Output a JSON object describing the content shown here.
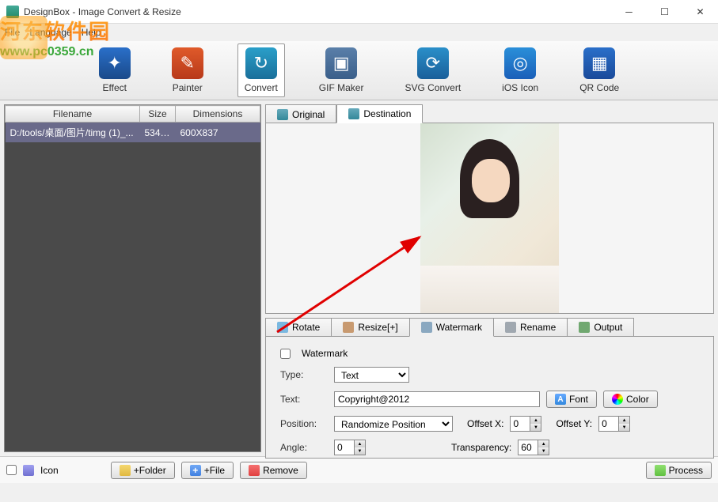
{
  "window": {
    "title": "DesignBox - Image Convert & Resize"
  },
  "watermark_overlay": {
    "cn_text": "河东软件园",
    "url": "www.pc0359.cn"
  },
  "menu": {
    "file": "File",
    "language": "Language",
    "help": "Help"
  },
  "toolbar": {
    "effect": "Effect",
    "painter": "Painter",
    "convert": "Convert",
    "gifmaker": "GIF Maker",
    "svgconvert": "SVG Convert",
    "iosicon": "iOS Icon",
    "qrcode": "QR Code"
  },
  "file_table": {
    "headers": {
      "filename": "Filename",
      "size": "Size",
      "dimensions": "Dimensions"
    },
    "rows": [
      {
        "filename": "D:/tools/桌面/图片/timg (1)_...",
        "size": "534....",
        "dimensions": "600X837"
      }
    ]
  },
  "preview_tabs": {
    "original": "Original",
    "destination": "Destination"
  },
  "settings_tabs": {
    "rotate": "Rotate",
    "resize": "Resize[+]",
    "watermark": "Watermark",
    "rename": "Rename",
    "output": "Output"
  },
  "watermark_panel": {
    "checkbox_label": "Watermark",
    "checked": false,
    "type_label": "Type:",
    "type_value": "Text",
    "text_label": "Text:",
    "text_value": "Copyright@2012",
    "font_btn": "Font",
    "color_btn": "Color",
    "position_label": "Position:",
    "position_value": "Randomize Position",
    "offsetx_label": "Offset X:",
    "offsetx_value": "0",
    "offsety_label": "Offset Y:",
    "offsety_value": "0",
    "angle_label": "Angle:",
    "angle_value": "0",
    "transparency_label": "Transparency:",
    "transparency_value": "60"
  },
  "bottom": {
    "icon_chk": "Icon",
    "add_folder": "+Folder",
    "add_file": "+File",
    "remove": "Remove",
    "process": "Process"
  }
}
